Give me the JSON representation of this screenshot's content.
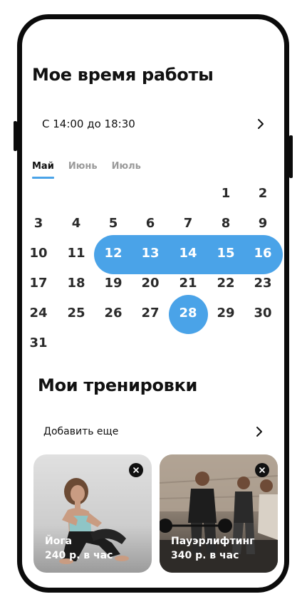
{
  "header": {
    "title": "Мое время работы"
  },
  "work_hours": {
    "label": "С 14:00 до 18:30"
  },
  "months": [
    {
      "label": "Май",
      "active": true
    },
    {
      "label": "Июнь",
      "active": false
    },
    {
      "label": "Июль",
      "active": false
    }
  ],
  "calendar": {
    "selected_range": [
      "12",
      "16"
    ],
    "highlighted_day": "28",
    "rows": [
      [
        "",
        "",
        "",
        "",
        "",
        "1",
        "2"
      ],
      [
        "3",
        "4",
        "5",
        "6",
        "7",
        "8",
        "9"
      ],
      [
        "10",
        "11",
        "12",
        "13",
        "14",
        "15",
        "16"
      ],
      [
        "17",
        "18",
        "19",
        "20",
        "21",
        "22",
        "23"
      ],
      [
        "24",
        "25",
        "26",
        "27",
        "28",
        "29",
        "30"
      ],
      [
        "31",
        "",
        "",
        "",
        "",
        "",
        ""
      ]
    ]
  },
  "trainings": {
    "title": "Мои тренировки",
    "add_more": "Добавить еще",
    "items": [
      {
        "name": "Йога",
        "price": "240 р. в час"
      },
      {
        "name": "Пауэрлифтинг",
        "price": "340 р. в час"
      }
    ]
  },
  "colors": {
    "accent": "#4aa3e8"
  }
}
